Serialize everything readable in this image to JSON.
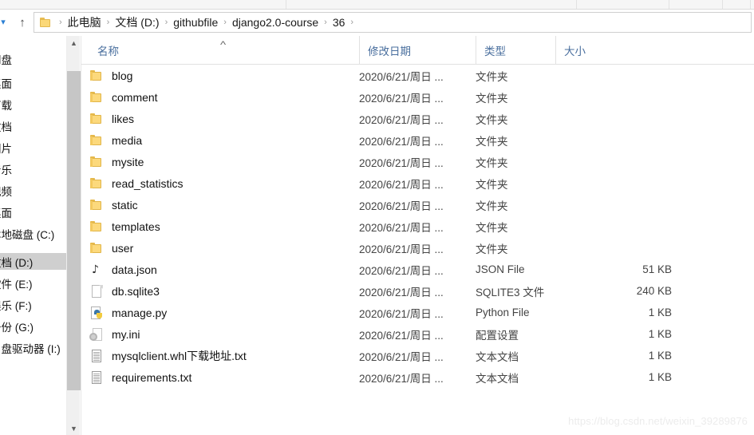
{
  "window": {
    "app": "File Explorer",
    "ribbon_separators": 5
  },
  "address_bar": {
    "back_dropdown_icon": "chevron-down-icon",
    "up_button_icon": "arrow-up-icon",
    "folder_icon": "folder-icon",
    "separator": "›",
    "crumbs": [
      "此电脑",
      "文档 (D:)",
      "githubfile",
      "django2.0-course",
      "36"
    ]
  },
  "nav_pane": {
    "items": [
      {
        "label": "网盘",
        "selected": false
      },
      {
        "label": "桌面",
        "selected": false
      },
      {
        "label": "下载",
        "selected": false
      },
      {
        "label": "文档",
        "selected": false
      },
      {
        "label": "图片",
        "selected": false
      },
      {
        "label": "音乐",
        "selected": false
      },
      {
        "label": "视频",
        "selected": false
      },
      {
        "label": "桌面",
        "selected": false
      },
      {
        "label": "本地磁盘 (C:)",
        "selected": false
      },
      {
        "label": "文档 (D:)",
        "selected": true
      },
      {
        "label": "软件 (E:)",
        "selected": false
      },
      {
        "label": "娱乐 (F:)",
        "selected": false
      },
      {
        "label": "备份 (G:)",
        "selected": false
      },
      {
        "label": "U 盘驱动器 (I:)",
        "selected": false
      }
    ],
    "scrollbar": {
      "up_icon": "chevron-up-icon",
      "down_icon": "chevron-down-icon"
    }
  },
  "columns": [
    {
      "key": "name",
      "label": "名称",
      "sorted": true,
      "sort_caret": "˄"
    },
    {
      "key": "date",
      "label": "修改日期",
      "sorted": false
    },
    {
      "key": "type",
      "label": "类型",
      "sorted": false
    },
    {
      "key": "size",
      "label": "大小",
      "sorted": false
    }
  ],
  "files": [
    {
      "name": "blog",
      "icon": "folder-icon",
      "date": "2020/6/21/周日 ...",
      "type": "文件夹",
      "size": ""
    },
    {
      "name": "comment",
      "icon": "folder-icon",
      "date": "2020/6/21/周日 ...",
      "type": "文件夹",
      "size": ""
    },
    {
      "name": "likes",
      "icon": "folder-icon",
      "date": "2020/6/21/周日 ...",
      "type": "文件夹",
      "size": ""
    },
    {
      "name": "media",
      "icon": "folder-icon",
      "date": "2020/6/21/周日 ...",
      "type": "文件夹",
      "size": ""
    },
    {
      "name": "mysite",
      "icon": "folder-icon",
      "date": "2020/6/21/周日 ...",
      "type": "文件夹",
      "size": ""
    },
    {
      "name": "read_statistics",
      "icon": "folder-icon",
      "date": "2020/6/21/周日 ...",
      "type": "文件夹",
      "size": ""
    },
    {
      "name": "static",
      "icon": "folder-icon",
      "date": "2020/6/21/周日 ...",
      "type": "文件夹",
      "size": ""
    },
    {
      "name": "templates",
      "icon": "folder-icon",
      "date": "2020/6/21/周日 ...",
      "type": "文件夹",
      "size": ""
    },
    {
      "name": "user",
      "icon": "folder-icon",
      "date": "2020/6/21/周日 ...",
      "type": "文件夹",
      "size": ""
    },
    {
      "name": "data.json",
      "icon": "json-file-icon",
      "date": "2020/6/21/周日 ...",
      "type": "JSON File",
      "size": "51 KB"
    },
    {
      "name": "db.sqlite3",
      "icon": "blank-file-icon",
      "date": "2020/6/21/周日 ...",
      "type": "SQLITE3 文件",
      "size": "240 KB"
    },
    {
      "name": "manage.py",
      "icon": "python-file-icon",
      "date": "2020/6/21/周日 ...",
      "type": "Python File",
      "size": "1 KB"
    },
    {
      "name": "my.ini",
      "icon": "config-file-icon",
      "date": "2020/6/21/周日 ...",
      "type": "配置设置",
      "size": "1 KB"
    },
    {
      "name": "mysqlclient.whl下载地址.txt",
      "icon": "text-file-icon",
      "date": "2020/6/21/周日 ...",
      "type": "文本文档",
      "size": "1 KB"
    },
    {
      "name": "requirements.txt",
      "icon": "text-file-icon",
      "date": "2020/6/21/周日 ...",
      "type": "文本文档",
      "size": "1 KB"
    }
  ],
  "watermark": "https://blog.csdn.net/weixin_39289876",
  "colors": {
    "folder": "#fcd97c",
    "header_text": "#4a6f9e",
    "selection": "#cfcfcf",
    "accent": "#2a7fd4"
  }
}
